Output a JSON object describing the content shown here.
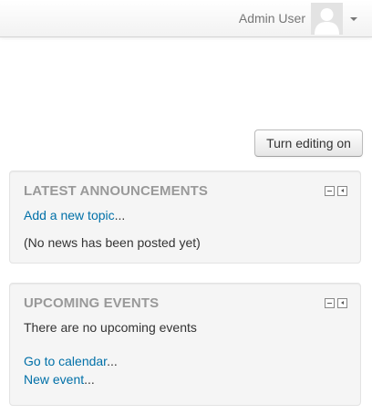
{
  "user_menu": {
    "username": "Admin User",
    "avatar_icon": "user-avatar-icon",
    "dropdown_icon": "caret-down-icon"
  },
  "editing": {
    "button_label": "Turn editing on"
  },
  "announcements_block": {
    "title": "LATEST ANNOUNCEMENTS",
    "add_topic_link": "Add a new topic",
    "add_topic_suffix": "...",
    "empty_message": "(No news has been posted yet)"
  },
  "events_block": {
    "title": "UPCOMING EVENTS",
    "empty_message": "There are no upcoming events",
    "calendar_link": "Go to calendar",
    "calendar_suffix": "...",
    "new_event_link": "New event",
    "new_event_suffix": "..."
  },
  "colors": {
    "link": "#0070a8",
    "block_title": "#999999",
    "block_background": "#f5f5f5"
  }
}
